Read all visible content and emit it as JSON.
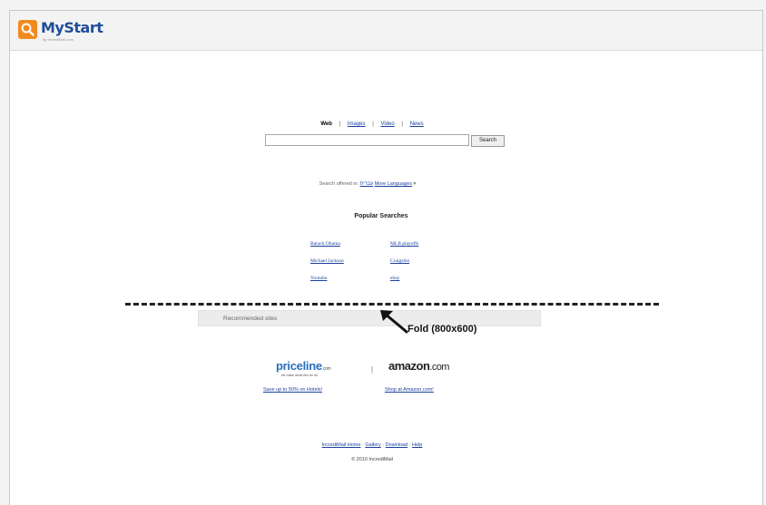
{
  "header": {
    "logo_text": "MyStart",
    "logo_subtitle": "By IncrediMail.com"
  },
  "search": {
    "tabs": [
      {
        "label": "Web",
        "active": true
      },
      {
        "label": "Images",
        "active": false
      },
      {
        "label": "Video",
        "active": false
      },
      {
        "label": "News",
        "active": false
      }
    ],
    "tab_separator": "|",
    "query": "",
    "button_label": "Search",
    "offered_prefix": "Search offered in:",
    "offered_language": "עברית",
    "more_languages": "More Languages",
    "more_arrow": "▾"
  },
  "popular": {
    "title": "Popular Searches",
    "items": [
      "Barack Obama",
      "MLB playoffs",
      "Michael Jackson",
      "Craigslist",
      "Youtube",
      "ebay"
    ]
  },
  "recommended": {
    "label": "Recommended sites"
  },
  "annotation": {
    "fold_label": "Fold (800x600)"
  },
  "sites": {
    "priceline_logo": "priceline",
    "priceline_suffix": ".com",
    "priceline_tagline": "we make deals like we do",
    "priceline_promo": "Save up to 50% on Hotels!",
    "separator": "|",
    "amazon_logo": "amazon",
    "amazon_suffix": ".com",
    "amazon_promo": "Shop at Amazon.com!"
  },
  "footer": {
    "links": [
      "IncrediMail Home",
      "Gallery",
      "Download",
      "Help"
    ],
    "link_separator": "·",
    "copyright": "© 2010 IncrediMail"
  },
  "colors": {
    "link": "#1a3fa0",
    "logo_orange": "#f08a1e",
    "logo_blue": "#1f4e9a",
    "priceline_blue": "#2a6fba"
  }
}
